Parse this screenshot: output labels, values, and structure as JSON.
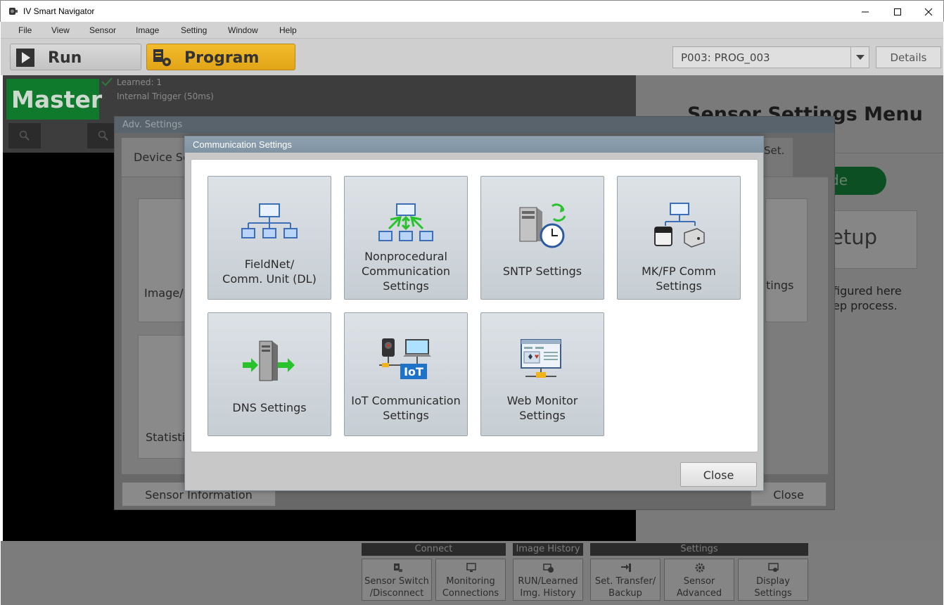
{
  "window": {
    "title": "IV Smart Navigator"
  },
  "menu": [
    "File",
    "View",
    "Sensor",
    "Image",
    "Setting",
    "Window",
    "Help"
  ],
  "toolbar": {
    "run_label": "Run",
    "program_label": "Program",
    "program_select": "P003: PROG_003",
    "details_label": "Details"
  },
  "status": {
    "master_label": "Master",
    "learned": "Learned: 1",
    "trigger": "Internal Trigger (50ms)"
  },
  "right_panel": {
    "title": "Sensor Settings Menu",
    "pill_fragment": "de",
    "setup_fragment": "etup",
    "desc_line1": "figured here",
    "desc_line2": "ep process."
  },
  "bottom": {
    "groups": [
      "Connect",
      "Image History",
      "Settings"
    ],
    "buttons": [
      {
        "line1": "Sensor Switch",
        "line2": "/Disconnect",
        "icon": "sensor-switch-icon"
      },
      {
        "line1": "Monitoring",
        "line2": "Connections",
        "icon": "monitor-icon"
      },
      {
        "line1": "RUN/Learned",
        "line2": "Img. History",
        "icon": "history-icon"
      },
      {
        "line1": "Set. Transfer/",
        "line2": "Backup",
        "icon": "transfer-icon"
      },
      {
        "line1": "Sensor",
        "line2": "Advanced",
        "icon": "gear-icon"
      },
      {
        "line1": "Display",
        "line2": "Settings",
        "icon": "display-settings-icon"
      }
    ]
  },
  "adv_dialog": {
    "title": "Adv. Settings",
    "tab_left": "Device Se",
    "tab_right": "Set.",
    "tile_image": "Image/F",
    "tile_statistic": "Statistic",
    "tile_right_text": "tings",
    "sensor_info": "Sensor Information",
    "close": "Close"
  },
  "comm_dialog": {
    "title": "Communication Settings",
    "tiles": [
      {
        "lines": [
          "FieldNet/",
          "Comm. Unit (DL)"
        ],
        "icon": "network-tree-icon"
      },
      {
        "lines": [
          "Nonprocedural",
          "Communication",
          "Settings"
        ],
        "icon": "nonprocedural-network-icon"
      },
      {
        "lines": [
          "SNTP Settings"
        ],
        "icon": "server-clock-icon"
      },
      {
        "lines": [
          "MK/FP Comm Settings"
        ],
        "icon": "mk-fp-network-icon"
      },
      {
        "lines": [
          "DNS Settings"
        ],
        "icon": "dns-server-icon"
      },
      {
        "lines": [
          "IoT Communication",
          "Settings"
        ],
        "icon": "iot-icon"
      },
      {
        "lines": [
          "Web Monitor",
          "Settings"
        ],
        "icon": "web-monitor-icon"
      }
    ],
    "close": "Close"
  },
  "colors": {
    "program_accent": "#e8ad1f",
    "master_green": "#0f7a2c",
    "dialog_title": "#8a9cab",
    "arrow_green": "#27c22c"
  }
}
